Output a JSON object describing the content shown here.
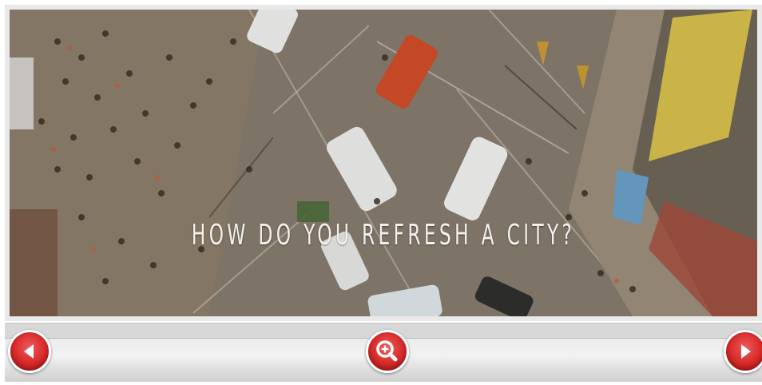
{
  "slide": {
    "caption": "HOW DO YOU REFRESH A CITY?",
    "image_description_icon": "aerial-city-photo-icon"
  },
  "toolbar": {
    "prev_icon": "arrow-left-icon",
    "zoom_icon": "zoom-in-icon",
    "next_icon": "arrow-right-icon",
    "accent_color": "#d62828"
  }
}
